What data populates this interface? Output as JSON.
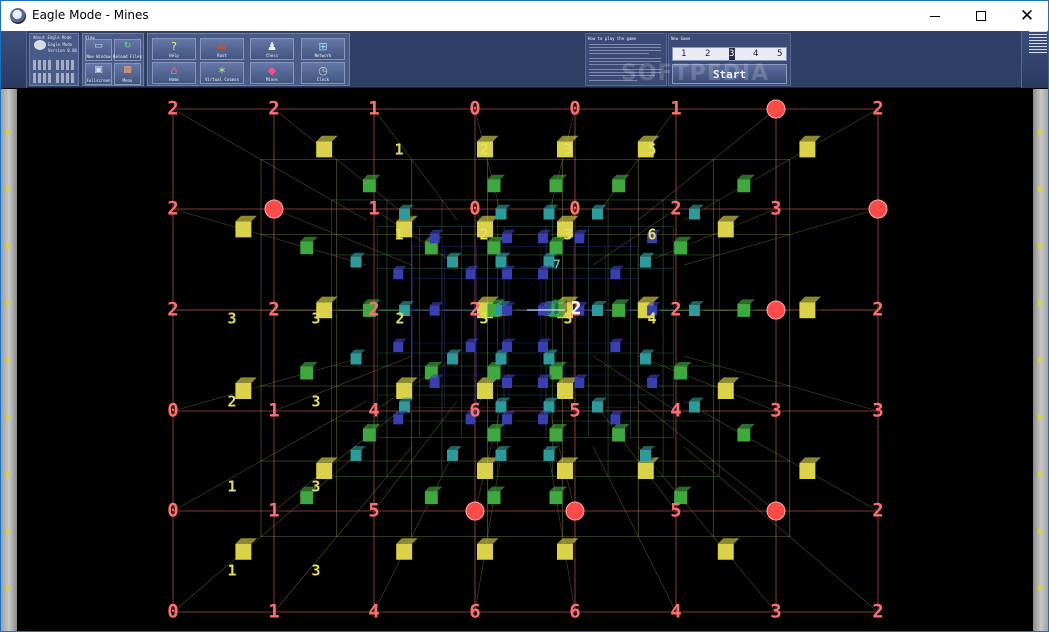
{
  "window": {
    "title": "Eagle Mode - Mines"
  },
  "toolbar": {
    "about": {
      "title": "About Eagle Mode",
      "lines": [
        "Eagle Mode",
        "Version 0.86"
      ]
    },
    "view": {
      "label": "View"
    },
    "commands": [
      {
        "label": "Help",
        "icon": "help-icon",
        "glyph": "?"
      },
      {
        "label": "Root",
        "icon": "root-icon",
        "glyph": "▬"
      },
      {
        "label": "Chess",
        "icon": "chess-icon",
        "glyph": "♟"
      },
      {
        "label": "Network",
        "icon": "network-icon",
        "glyph": "⊞"
      },
      {
        "label": "Home",
        "icon": "home-icon",
        "glyph": "⌂"
      },
      {
        "label": "Virtual Cosmos",
        "icon": "cosmos-icon",
        "glyph": "✶"
      },
      {
        "label": "Mines",
        "icon": "mines-icon",
        "glyph": "◆"
      },
      {
        "label": "Clock",
        "icon": "clock-icon",
        "glyph": "◷"
      }
    ],
    "view_buttons": [
      {
        "label": "New Window",
        "icon": "new-window-icon",
        "glyph": "▭"
      },
      {
        "label": "Reload Files",
        "icon": "reload-icon",
        "glyph": "↻"
      },
      {
        "label": "Fullscreen",
        "icon": "fullscreen-icon",
        "glyph": "▣"
      },
      {
        "label": "Menu",
        "icon": "menu-icon",
        "glyph": "▦"
      }
    ],
    "help": {
      "title": "How to play the game"
    },
    "game": {
      "title": "New Game",
      "levels": [
        "1",
        "2",
        "3",
        "4",
        "5"
      ],
      "start_label": "Start",
      "selected_level": 3
    },
    "watermark": "SOFTPEDIA"
  },
  "colors": {
    "toolbar": "#2f3f66",
    "number_outer": "#ff6f6f",
    "number_mid": "#e2e060",
    "number_inner": "#5bc0b8",
    "highlight": "#ffffff",
    "mine": "#ff4a4a",
    "cube_yellow": "#d9d24a",
    "cube_green": "#3fa83f",
    "cube_teal": "#2f9a9a",
    "cube_blue": "#3a3fb0"
  },
  "board": {
    "cursor_number": "2",
    "outer_numbers": [
      [
        "2",
        "2",
        "1",
        "0",
        "0",
        "1",
        "*",
        "2"
      ],
      [
        "2",
        "*",
        "1",
        "0",
        "0",
        "2",
        "3",
        "*"
      ],
      [
        "2",
        "2",
        "2",
        "2",
        "2",
        "2",
        "*",
        "2"
      ],
      [
        "0",
        "1",
        "4",
        "6",
        "5",
        "4",
        "3",
        "3"
      ],
      [
        "0",
        "1",
        "5",
        "*",
        "*",
        "5",
        "*",
        "2"
      ],
      [
        "0",
        "1",
        "4",
        "6",
        "6",
        "4",
        "3",
        "2"
      ]
    ],
    "inner_numbers": [
      {
        "v": "1",
        "ring": 1
      },
      {
        "v": "2",
        "ring": 1
      },
      {
        "v": "3",
        "ring": 1
      },
      {
        "v": "5",
        "ring": 1
      },
      {
        "v": "1",
        "ring": 1
      },
      {
        "v": "2",
        "ring": 1
      },
      {
        "v": "3",
        "ring": 1
      },
      {
        "v": "6",
        "ring": 1
      },
      {
        "v": "3",
        "ring": 1
      },
      {
        "v": "3",
        "ring": 1
      },
      {
        "v": "2",
        "ring": 1
      },
      {
        "v": "3",
        "ring": 1
      },
      {
        "v": "3",
        "ring": 1
      },
      {
        "v": "4",
        "ring": 1
      },
      {
        "v": "2",
        "ring": 1
      },
      {
        "v": "3",
        "ring": 1
      },
      {
        "v": "1",
        "ring": 1
      },
      {
        "v": "3",
        "ring": 1
      },
      {
        "v": "1",
        "ring": 1
      },
      {
        "v": "3",
        "ring": 1
      },
      {
        "v": "7",
        "ring": 2
      }
    ]
  }
}
